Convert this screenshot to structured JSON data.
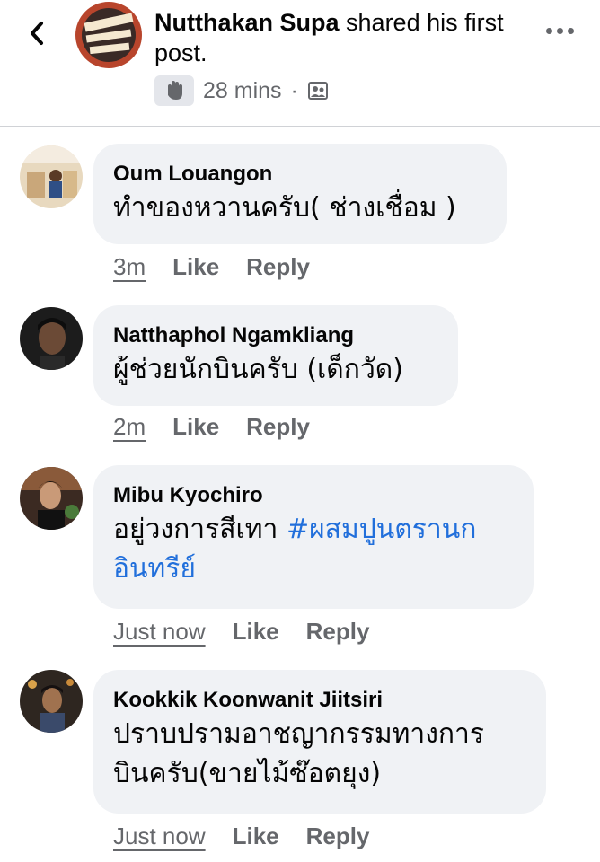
{
  "header": {
    "author": "Nutthakan Supa",
    "action": " shared his first post.",
    "time": "28 mins",
    "separator": "·"
  },
  "comments": [
    {
      "name": "Oum Louangon",
      "text": "ทำของหวานครับ( ช่างเชื่อม )",
      "time": "3m",
      "like": "Like",
      "reply": "Reply"
    },
    {
      "name": "Natthaphol Ngamkliang",
      "text": "ผู้ช่วยนักบินครับ (เด็กวัด)",
      "time": "2m",
      "like": "Like",
      "reply": "Reply"
    },
    {
      "name": "Mibu Kyochiro",
      "text_prefix": "อยู่วงการสีเทา ",
      "hashtag": "#ผสมปูนตรานก",
      "hashtag_line2": "อินทรีย์",
      "time": "Just now",
      "like": "Like",
      "reply": "Reply"
    },
    {
      "name": "Kookkik Koonwanit Jiitsiri",
      "text_line1": "ปราบปรามอาชญากรรมทางการ",
      "text_line2": "บินครับ(ขายไม้ซ๊อตยุง)",
      "time": "Just now",
      "like": "Like",
      "reply": "Reply"
    }
  ],
  "colors": {
    "bubble": "#f0f2f5",
    "secondary_text": "#65676b",
    "hashtag": "#216fdb"
  }
}
